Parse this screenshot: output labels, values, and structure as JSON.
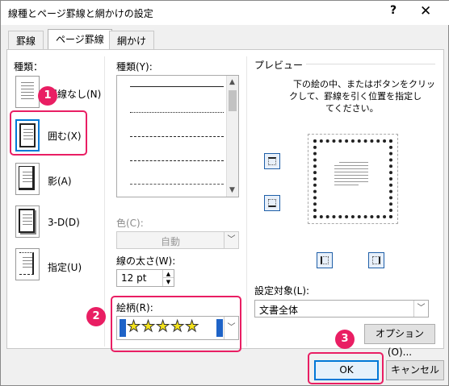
{
  "window": {
    "title": "線種とページ罫線と網かけの設定",
    "help_glyph": "?",
    "close_glyph": "✕"
  },
  "tabs": [
    {
      "label": "罫線"
    },
    {
      "label": "ページ罫線"
    },
    {
      "label": "網かけ"
    }
  ],
  "setting": {
    "heading": "種類：",
    "items": [
      {
        "label": "罫線なし(N)"
      },
      {
        "label": "囲む(X)"
      },
      {
        "label": "影(A)"
      },
      {
        "label": "3-D(D)"
      },
      {
        "label": "指定(U)"
      }
    ]
  },
  "style": {
    "heading": "種類(Y):",
    "line_styles": [
      "solid",
      "dotted",
      "dashed-short",
      "dashed",
      "dash-dot"
    ]
  },
  "color": {
    "label": "色(C):",
    "value": "自動"
  },
  "width": {
    "label": "線の太さ(W):",
    "value": "12 pt"
  },
  "art": {
    "label": "絵柄(R):",
    "value": "★★★★★"
  },
  "preview": {
    "heading": "プレビュー",
    "instruction_line1": "下の絵の中、またはボタンをクリッ",
    "instruction_line2": "クして、罫線を引く位置を指定し",
    "instruction_line3": "てください。"
  },
  "apply_to": {
    "label": "設定対象(L):",
    "value": "文書全体"
  },
  "buttons": {
    "options": "オプション(O)...",
    "ok": "OK",
    "cancel": "キャンセル"
  },
  "badges": [
    "1",
    "2",
    "3"
  ],
  "colors": {
    "highlight": "#e91e63",
    "accent": "#0078d7"
  }
}
